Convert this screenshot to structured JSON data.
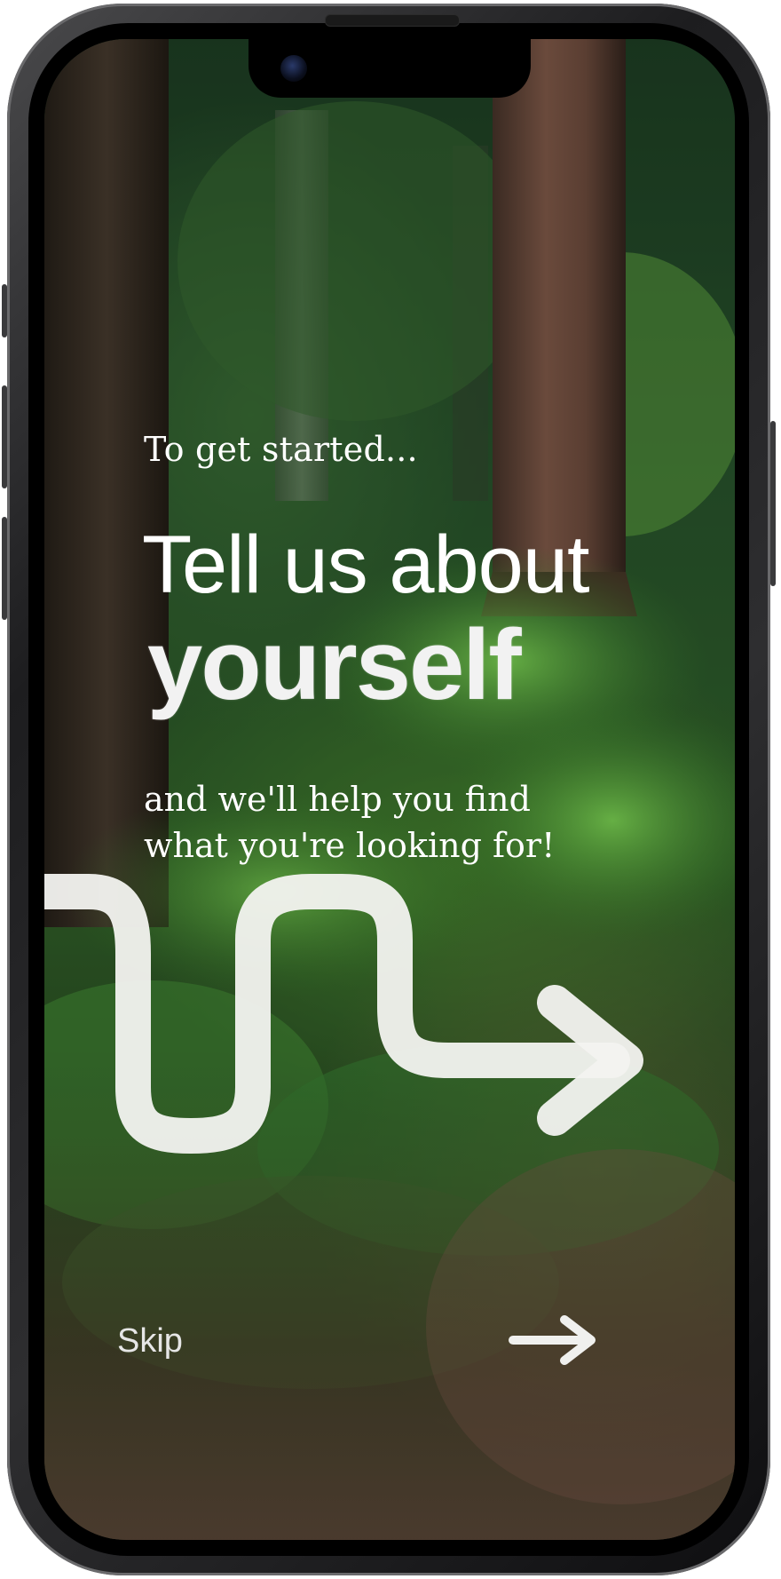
{
  "onboarding": {
    "intro": "To get started...",
    "headline": "Tell us about",
    "headline_emphasis": "yourself",
    "subtitle_line1": "and we'll help you find",
    "subtitle_line2": "what you're looking for!"
  },
  "footer": {
    "skip_label": "Skip",
    "next_icon": "right-arrow-icon"
  },
  "decor": {
    "path_icon": "winding-path-arrow-icon",
    "background": "forest-photo"
  }
}
